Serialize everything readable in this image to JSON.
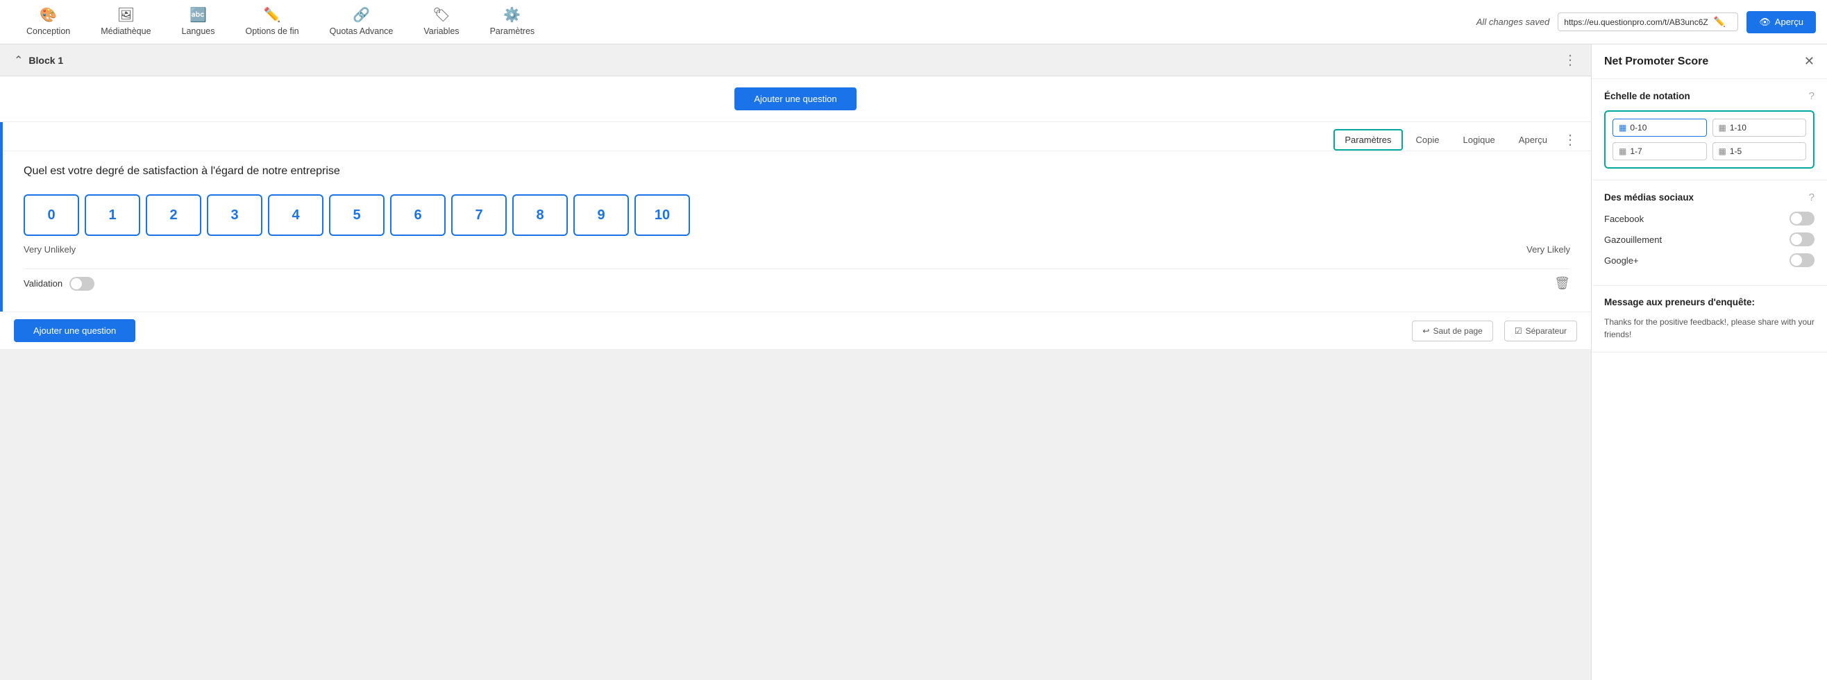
{
  "nav": {
    "items": [
      {
        "id": "conception",
        "label": "Conception",
        "icon": "🎨"
      },
      {
        "id": "mediatheque",
        "label": "Médiathèque",
        "icon": "🖼"
      },
      {
        "id": "langues",
        "label": "Langues",
        "icon": "🔤"
      },
      {
        "id": "options-fin",
        "label": "Options de fin",
        "icon": "✏️"
      },
      {
        "id": "quotas-advance",
        "label": "Quotas Advance",
        "icon": "🔗"
      },
      {
        "id": "variables",
        "label": "Variables",
        "icon": "🏷"
      },
      {
        "id": "parametres",
        "label": "Paramètres",
        "icon": "⚙️"
      }
    ],
    "all_saved": "All changes saved",
    "url": "https://eu.questionpro.com/t/AB3unc6Z",
    "apercu_label": "Aperçu"
  },
  "block": {
    "title": "Block 1",
    "add_question_label": "Ajouter une question"
  },
  "question": {
    "tabs": [
      {
        "id": "parametres",
        "label": "Paramètres",
        "active": true
      },
      {
        "id": "copie",
        "label": "Copie",
        "active": false
      },
      {
        "id": "logique",
        "label": "Logique",
        "active": false
      },
      {
        "id": "apercu",
        "label": "Aperçu",
        "active": false
      }
    ],
    "text": "Quel est votre degré de satisfaction à l'égard de notre entreprise",
    "scale": [
      "0",
      "1",
      "2",
      "3",
      "4",
      "5",
      "6",
      "7",
      "8",
      "9",
      "10"
    ],
    "label_left": "Very Unlikely",
    "label_right": "Very Likely",
    "validation_label": "Validation",
    "add_question_bottom": "Ajouter une question"
  },
  "bottom_bar": {
    "saut_page": "Saut de page",
    "separateur": "Séparateur"
  },
  "right_panel": {
    "title": "Net Promoter Score",
    "echelle": {
      "title": "Échelle de notation",
      "options": [
        {
          "label": "0-10",
          "active": true
        },
        {
          "label": "1-10",
          "active": false
        },
        {
          "label": "1-7",
          "active": false
        },
        {
          "label": "1-5",
          "active": false
        }
      ]
    },
    "social": {
      "title": "Des médias sociaux",
      "items": [
        {
          "label": "Facebook",
          "on": false
        },
        {
          "label": "Gazouillement",
          "on": false
        },
        {
          "label": "Google+",
          "on": false
        }
      ]
    },
    "message": {
      "title": "Message aux preneurs d'enquête:",
      "text": "Thanks for the positive feedback!, please share with your friends!"
    }
  }
}
